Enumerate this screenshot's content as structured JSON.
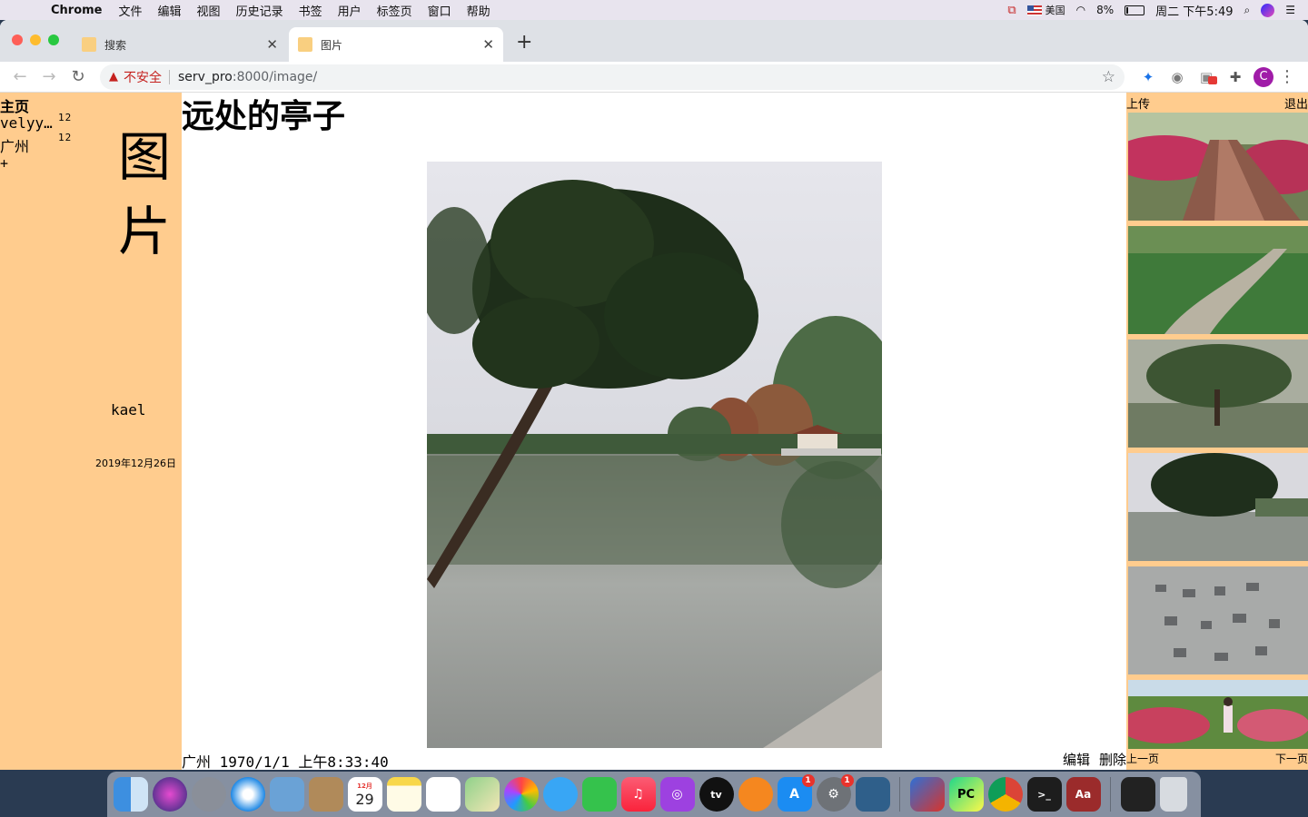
{
  "menubar": {
    "app_name": "Chrome",
    "menus": [
      "文件",
      "编辑",
      "视图",
      "历史记录",
      "书签",
      "用户",
      "标签页",
      "窗口",
      "帮助"
    ],
    "input_source": "美国",
    "battery": "8%",
    "clock": "周二 下午5:49"
  },
  "browser": {
    "tabs": [
      {
        "title": "搜索",
        "active": false
      },
      {
        "title": "图片",
        "active": true
      }
    ],
    "security_label": "不安全",
    "url_host": "serv_pro",
    "url_rest": ":8000/image/",
    "profile_initial": "C"
  },
  "sidebar": {
    "home": "主页",
    "albums": [
      {
        "name": "velyy…",
        "count": "12"
      },
      {
        "name": "广州",
        "count": "12"
      }
    ],
    "add": "+",
    "title": "图片",
    "user": "kael",
    "date": "2019年12月26日"
  },
  "main": {
    "title": "远处的亭子",
    "caption": "广州 1970/1/1 上午8:33:40",
    "edit": "编辑",
    "delete": "删除"
  },
  "rightbar": {
    "upload": "上传",
    "logout": "退出",
    "prev": "上一页",
    "next": "下一页",
    "thumbnails": [
      "garden-path-flowers",
      "stone-path-grass",
      "tree-by-lake",
      "tree-lake-reflection",
      "calligraphy-stone",
      "rose-garden-person"
    ]
  },
  "dock": {
    "apps": [
      "Finder",
      "Siri",
      "Launchpad",
      "Safari",
      "Preview",
      "Contacts",
      "Calendar",
      "Notes",
      "Reminders",
      "Maps",
      "Photos",
      "Messages",
      "FaceTime",
      "Music",
      "Podcasts",
      "TV",
      "Books",
      "App Store",
      "System Preferences",
      "MySQL Workbench",
      "Parallels",
      "PyCharm",
      "Chrome",
      "Terminal",
      "Dictionary",
      "Screen",
      "Trash"
    ],
    "calendar_day": "29",
    "calendar_month": "12月",
    "appstore_badge": "1",
    "prefs_badge": "1",
    "pycharm_label": "PC",
    "dictionary_label": "Aa",
    "tv_label": "tv"
  }
}
